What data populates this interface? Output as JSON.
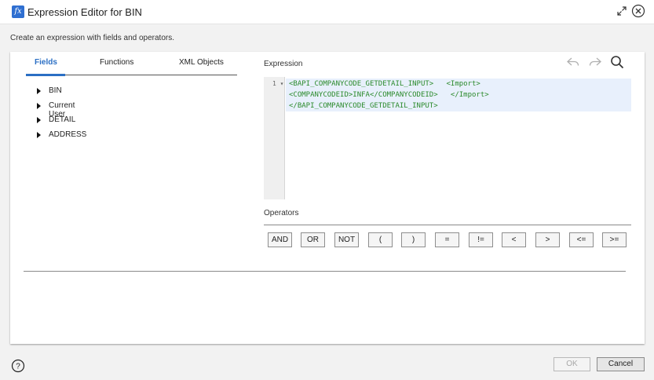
{
  "window": {
    "title": "Expression Editor for BIN",
    "icon": "fx-icon",
    "subtitle": "Create an expression with fields and operators."
  },
  "tabs": [
    {
      "label": "Fields",
      "active": true
    },
    {
      "label": "Functions",
      "active": false
    },
    {
      "label": "XML Objects",
      "active": false
    }
  ],
  "tree": [
    {
      "label": "BIN"
    },
    {
      "label": "Current User"
    },
    {
      "label": "DETAIL"
    },
    {
      "label": "ADDRESS"
    }
  ],
  "expression": {
    "label": "Expression",
    "line_number": "1",
    "lines": [
      "<BAPI_COMPANYCODE_GETDETAIL_INPUT>   <Import>",
      "<COMPANYCODEID>INFA</COMPANYCODEID>   </Import>",
      "</BAPI_COMPANYCODE_GETDETAIL_INPUT>"
    ],
    "code_color": "#2b8a2b",
    "highlight_color": "#e8f0fc"
  },
  "operators": {
    "label": "Operators",
    "buttons": [
      "AND",
      "OR",
      "NOT",
      "(",
      ")",
      "=",
      "!=",
      "<",
      ">",
      "<=",
      ">="
    ]
  },
  "footer": {
    "ok_label": "OK",
    "ok_enabled": false,
    "cancel_label": "Cancel"
  },
  "colors": {
    "accent": "#2b6fc4"
  }
}
